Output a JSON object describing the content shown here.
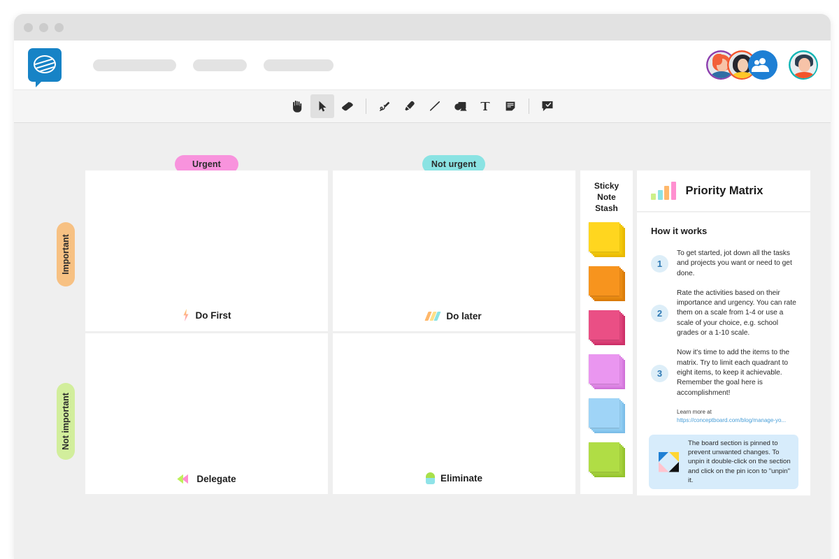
{
  "window": {
    "dots": [
      "close",
      "minimize",
      "maximize"
    ]
  },
  "header": {
    "logo_name": "conceptboard-logo",
    "nav_placeholders": [
      "",
      "",
      ""
    ],
    "collaborators": [
      {
        "name": "collaborator-1",
        "ring_color": "#8c3fae"
      },
      {
        "name": "collaborator-2",
        "ring_color": "#f2552c"
      }
    ],
    "add_people_label": "add-people",
    "user_avatar_label": "current-user"
  },
  "toolbar": {
    "tools": [
      {
        "id": "hand",
        "label": "Hand / Pan",
        "active": false
      },
      {
        "id": "cursor",
        "label": "Select",
        "active": true
      },
      {
        "id": "eraser",
        "label": "Eraser",
        "active": false
      },
      {
        "id": "sep1",
        "label": "divider",
        "active": false
      },
      {
        "id": "pen",
        "label": "Pen",
        "active": false
      },
      {
        "id": "marker",
        "label": "Highlighter",
        "active": false
      },
      {
        "id": "line",
        "label": "Line",
        "active": false
      },
      {
        "id": "shapes",
        "label": "Shapes",
        "active": false
      },
      {
        "id": "text",
        "label": "Text",
        "active": false
      },
      {
        "id": "sticky",
        "label": "Sticky Note",
        "active": false
      },
      {
        "id": "sep2",
        "label": "divider",
        "active": false
      },
      {
        "id": "comment",
        "label": "Comment",
        "active": false
      }
    ]
  },
  "matrix": {
    "column_labels": [
      {
        "text": "Urgent",
        "color": "#f893dd"
      },
      {
        "text": "Not urgent",
        "color": "#8ae3e3"
      }
    ],
    "row_labels": [
      {
        "text": "Important",
        "color": "#f7c183"
      },
      {
        "text": "Not important",
        "color": "#d2ee9c"
      }
    ],
    "quadrants": [
      {
        "id": "do-first",
        "label": "Do First",
        "icon": "lightning-bolt-icon"
      },
      {
        "id": "do-later",
        "label": "Do later",
        "icon": "slanted-bars-icon"
      },
      {
        "id": "delegate",
        "label": "Delegate",
        "icon": "double-left-arrow-icon"
      },
      {
        "id": "eliminate",
        "label": "Eliminate",
        "icon": "drop-icon"
      }
    ]
  },
  "sticky_stash": {
    "title": "Sticky\nNote\nStash",
    "title_lines": [
      "Sticky",
      "Note",
      "Stash"
    ],
    "notes": [
      {
        "name": "sticky-note-yellow",
        "color": "#ffd61f",
        "shadow": "#e8b800"
      },
      {
        "name": "sticky-note-orange",
        "color": "#f7941e",
        "shadow": "#da7a08"
      },
      {
        "name": "sticky-note-pink",
        "color": "#ea4f85",
        "shadow": "#cc2f67"
      },
      {
        "name": "sticky-note-purple",
        "color": "#ea96f0",
        "shadow": "#d072d8"
      },
      {
        "name": "sticky-note-blue",
        "color": "#9fd4f7",
        "shadow": "#7bbde8"
      },
      {
        "name": "sticky-note-green",
        "color": "#b0dd45",
        "shadow": "#93c22c"
      }
    ]
  },
  "info_panel": {
    "title": "Priority Matrix",
    "chart_icon_bars": [
      {
        "color": "#cdf08a",
        "height": 9
      },
      {
        "color": "#8ce3e3",
        "height": 14
      },
      {
        "color": "#ffb86b",
        "height": 20
      },
      {
        "color": "#ff8fd0",
        "height": 26
      }
    ],
    "section_heading": "How it works",
    "steps": [
      {
        "number": "1",
        "text": "To get started, jot down all the tasks and projects you want or need to get done."
      },
      {
        "number": "2",
        "text": "Rate the activities based on their importance and urgency. You can rate them on a scale from 1-4 or use a scale of your choice, e.g. school grades or a 1-10 scale."
      },
      {
        "number": "3",
        "text": "Now it's time to add the items to the matrix. Try to limit each quadrant to eight items, to keep it achievable. Remember the goal here is accomplishment!"
      }
    ],
    "learn_more_label": "Learn more at",
    "learn_more_url": "https://conceptboard.com/blog/manage-yo...",
    "pin_note": {
      "icon": "pinned-section-icon",
      "text": "The board section is pinned to prevent unwanted changes. To unpin it double-click on the section and click on the pin icon to \"unpin\" it."
    }
  },
  "colors": {
    "canvas_bg": "#efefef",
    "panel_bg": "#ffffff",
    "brand_blue": "#1783c6",
    "accent_blue": "#2e79b5",
    "highlight_yellow": "#fbe98a",
    "info_note_bg": "#d7ecfb"
  }
}
